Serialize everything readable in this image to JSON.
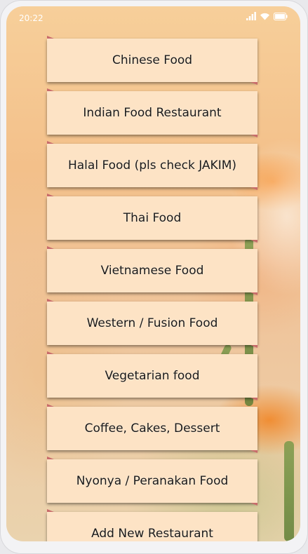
{
  "status_bar": {
    "time": "20:22",
    "icons": [
      "signal-icon",
      "wifi-icon",
      "battery-icon"
    ]
  },
  "menu": {
    "items": [
      {
        "label": "Chinese Food"
      },
      {
        "label": "Indian Food Restaurant"
      },
      {
        "label": "Halal Food (pls check JAKIM)"
      },
      {
        "label": "Thai Food"
      },
      {
        "label": "Vietnamese Food"
      },
      {
        "label": "Western / Fusion Food"
      },
      {
        "label": "Vegetarian food"
      },
      {
        "label": "Coffee, Cakes, Dessert"
      },
      {
        "label": "Nyonya / Peranakan Food"
      },
      {
        "label": "Add New Restaurant"
      }
    ]
  },
  "colors": {
    "button_bg": "#fde3c5",
    "button_corner": "#c86b6b",
    "status_text": "#ffffff"
  }
}
